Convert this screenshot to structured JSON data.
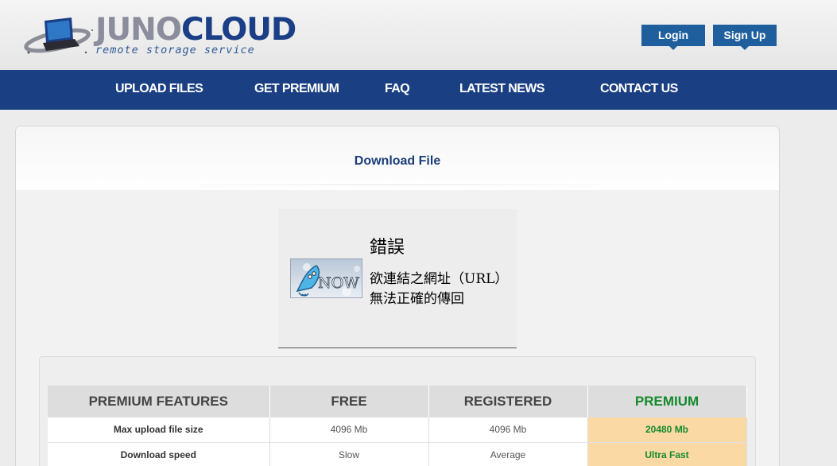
{
  "header": {
    "logo_name": "JUNO",
    "logo_name_accent": "CLOUD",
    "logo_tagline": "remote storage service",
    "login_label": "Login",
    "signup_label": "Sign Up"
  },
  "nav": {
    "items": [
      {
        "label": "UPLOAD FILES"
      },
      {
        "label": "GET PREMIUM"
      },
      {
        "label": "FAQ"
      },
      {
        "label": "LATEST NEWS"
      },
      {
        "label": "CONTACT US"
      }
    ]
  },
  "main": {
    "title": "Download File",
    "error": {
      "image_text": "NOW",
      "title": "錯誤",
      "message": "欲連結之網址（URL）無法正確的傳回"
    }
  },
  "features_table": {
    "headers": [
      "PREMIUM FEATURES",
      "FREE",
      "REGISTERED",
      "PREMIUM"
    ],
    "rows": [
      {
        "feature": "Max upload file size",
        "free": "4096 Mb",
        "registered": "4096 Mb",
        "premium": "20480 Mb"
      },
      {
        "feature": "Download speed",
        "free": "Slow",
        "registered": "Average",
        "premium": "Ultra Fast"
      }
    ]
  },
  "colors": {
    "brand_blue": "#1a4083",
    "premium_green": "#158a2c",
    "premium_highlight": "#fad9a5"
  }
}
